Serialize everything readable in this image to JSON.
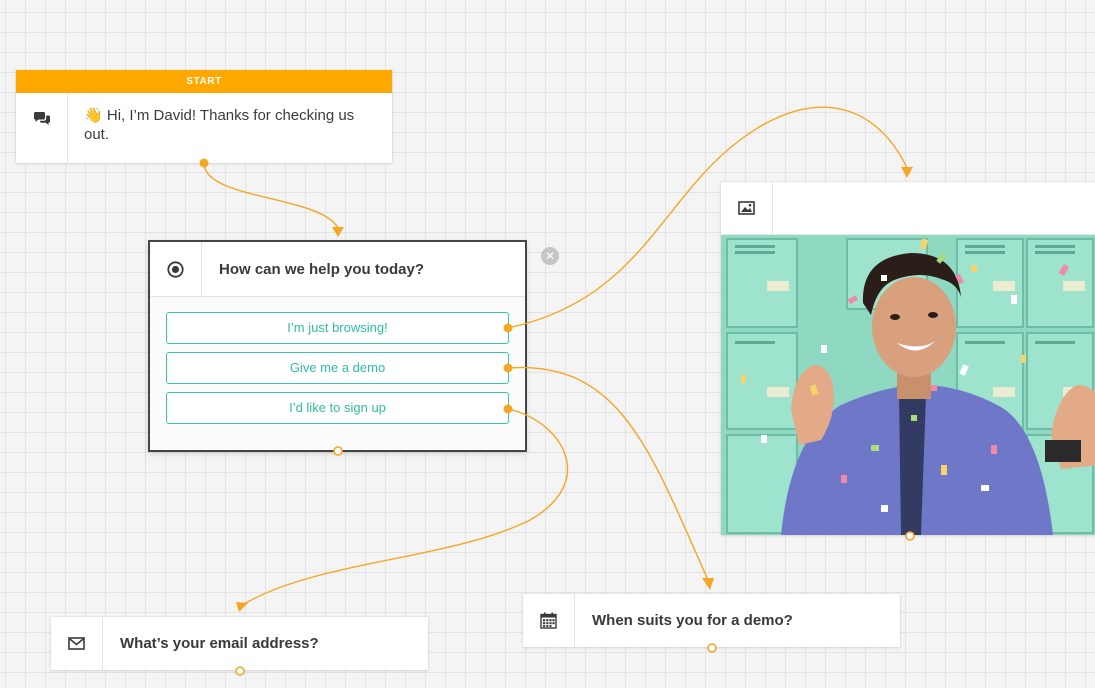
{
  "start_node": {
    "badge": "START",
    "emoji": "👋",
    "message": "Hi, I’m David! Thanks for checking us out.",
    "icon": "chat-bubbles-icon"
  },
  "question_node": {
    "icon": "radio-target-icon",
    "title": "How can we help you today?",
    "answers": [
      "I’m just browsing!",
      "Give me a demo",
      "I’d like to sign up"
    ],
    "delete_icon": "close-circle-icon"
  },
  "image_node": {
    "icon": "image-icon",
    "media": "celebrating man in confetti animated image"
  },
  "demo_node": {
    "icon": "calendar-icon",
    "title": "When suits you for a demo?"
  },
  "email_node": {
    "icon": "envelope-icon",
    "title": "What’s your email address?"
  },
  "colors": {
    "accent": "#ffa800",
    "answer_border": "#36c9a6",
    "answer_text": "#2fbf9c",
    "connector": "#f5a623",
    "canvas_bg": "#f4f4f4"
  }
}
